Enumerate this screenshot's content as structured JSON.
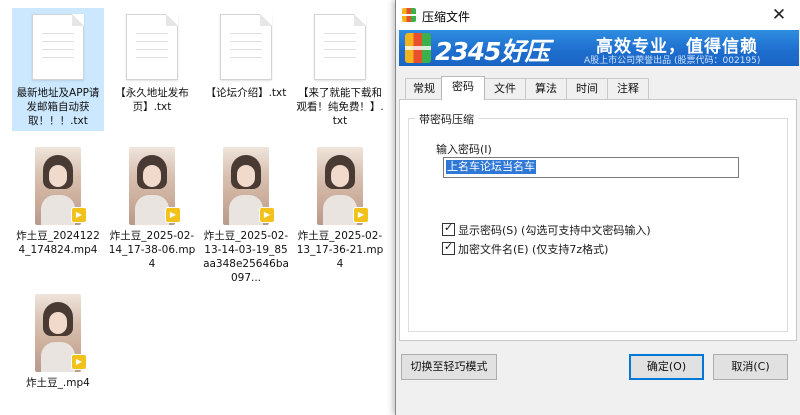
{
  "explorer": {
    "files": [
      {
        "name": "最新地址及APP请发邮箱自动获取！！！.txt",
        "type": "txt",
        "selected": true
      },
      {
        "name": "【永久地址发布页】.txt",
        "type": "txt"
      },
      {
        "name": "【论坛介绍】.txt",
        "type": "txt"
      },
      {
        "name": "【来了就能下载和观看！纯免费！】.txt",
        "type": "txt"
      },
      {
        "name": "炸土豆_20241224_174824.mp4",
        "type": "mp4"
      },
      {
        "name": "炸土豆_2025-02-14_17-38-06.mp4",
        "type": "mp4"
      },
      {
        "name": "炸土豆_2025-02-13-14-03-19_85aa348e25646ba097...",
        "type": "mp4"
      },
      {
        "name": "炸土豆_2025-02-13_17-36-21.mp4",
        "type": "mp4"
      },
      {
        "name": "炸土豆_.mp4",
        "type": "mp4"
      }
    ]
  },
  "dialog": {
    "title": "压缩文件",
    "close_label": "✕",
    "banner": {
      "brand": "2345好压",
      "slogan": "高效专业，值得信赖",
      "sub": "A股上市公司荣誉出品 (股票代码：002195)"
    },
    "tabs": [
      "常规",
      "密码",
      "文件",
      "算法",
      "时间",
      "注释"
    ],
    "active_tab": "密码",
    "group_title": "带密码压缩",
    "password_label": "输入密码(I)",
    "password_value": "上名车论坛当名车",
    "show_password_label": "显示密码(S) (勾选可支持中文密码输入)",
    "encrypt_names_label": "加密文件名(E) (仅支持7z格式)",
    "show_password_checked": true,
    "encrypt_names_checked": true,
    "buttons": {
      "switch_mode": "切换至轻巧模式",
      "ok": "确定(O)",
      "cancel": "取消(C)"
    },
    "colors": {
      "banner": "#1f6fcf",
      "selection": "#3078d6",
      "primary_border": "#0078d7"
    }
  }
}
